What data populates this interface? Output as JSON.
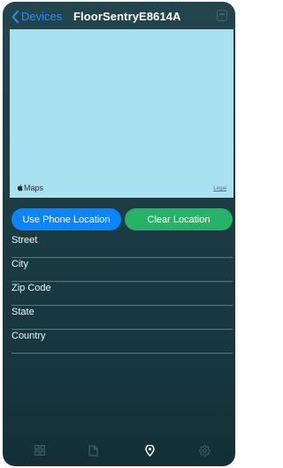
{
  "nav": {
    "back_label": "Devices",
    "title": "FloorSentryE8614A"
  },
  "map": {
    "brand": "Maps",
    "legal": "Legal"
  },
  "buttons": {
    "use_phone_location": "Use Phone Location",
    "clear_location": "Clear Location"
  },
  "fields": [
    {
      "placeholder": "Street"
    },
    {
      "placeholder": "City"
    },
    {
      "placeholder": "Zip Code"
    },
    {
      "placeholder": "State"
    },
    {
      "placeholder": "Country"
    }
  ],
  "tabbar": {
    "tabs": [
      {
        "icon": "grid-icon",
        "active": false
      },
      {
        "icon": "document-icon",
        "active": false
      },
      {
        "icon": "location-pin-icon",
        "active": true
      },
      {
        "icon": "gear-icon",
        "active": false
      }
    ]
  },
  "colors": {
    "accent_blue": "#0a84ff",
    "accent_green": "#26b269",
    "map_water": "#a8e2f1",
    "background": "#1c3c44"
  }
}
